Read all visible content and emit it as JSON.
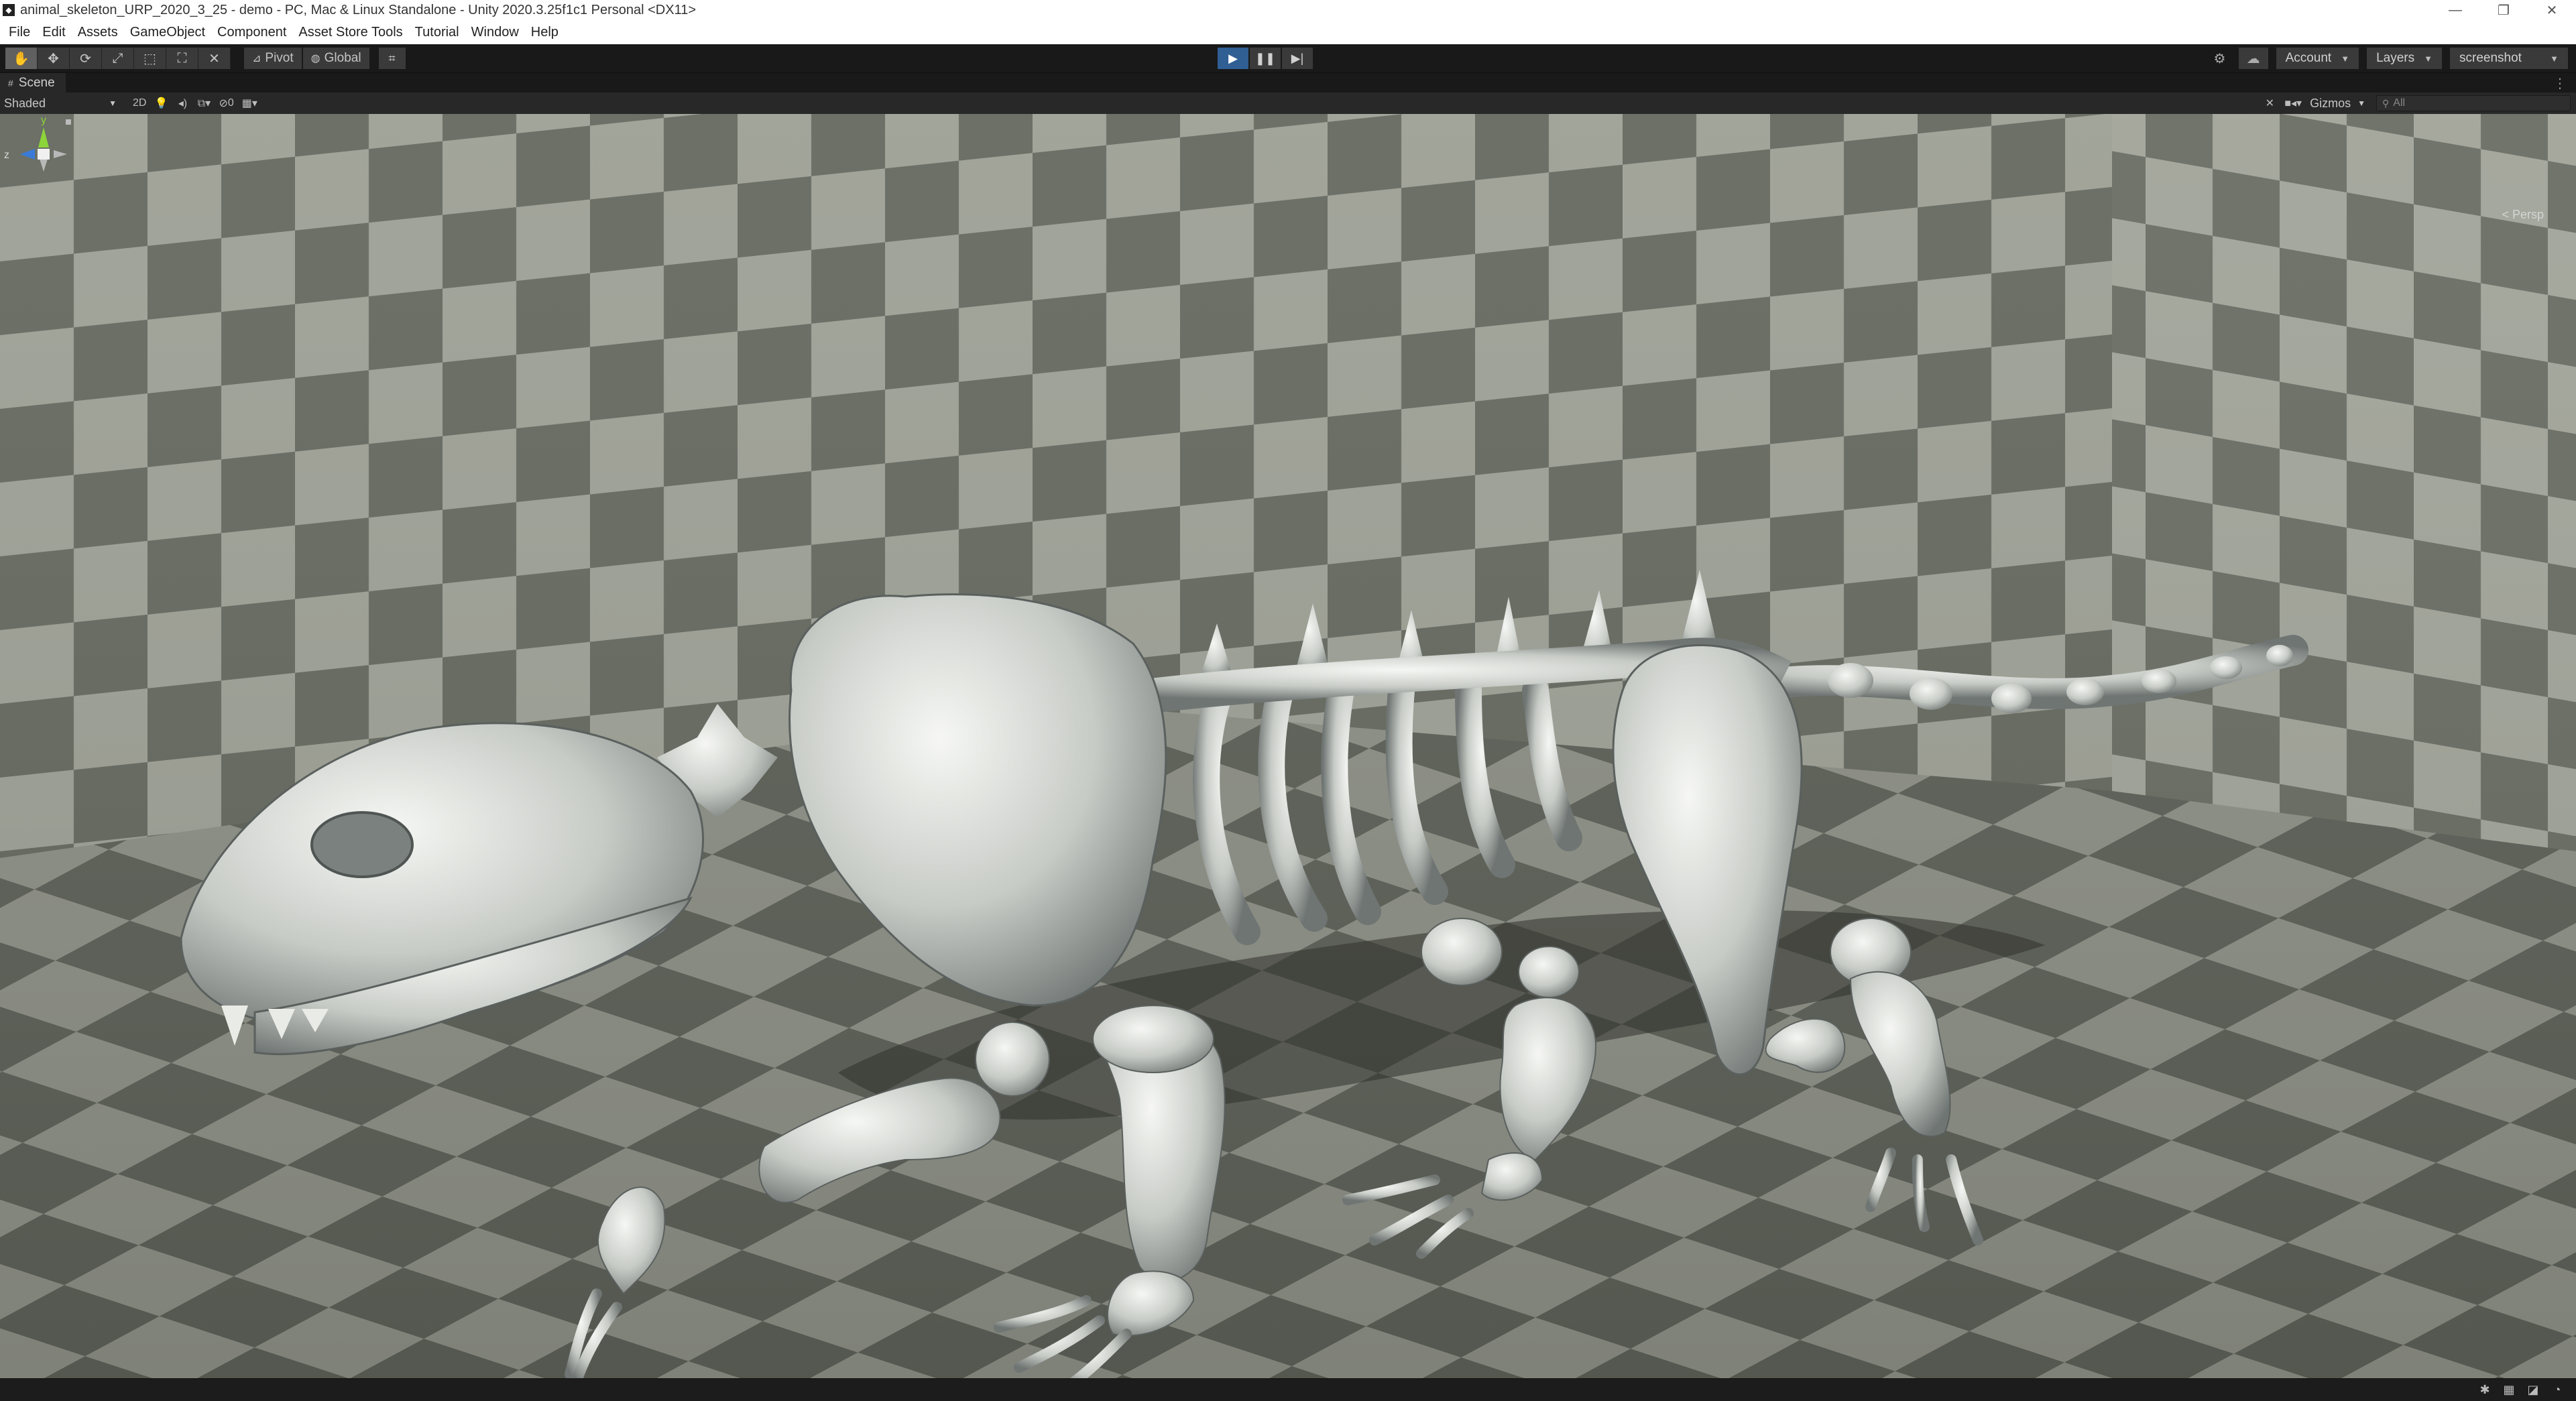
{
  "window": {
    "title": "animal_skeleton_URP_2020_3_25 - demo - PC, Mac & Linux Standalone - Unity 2020.3.25f1c1 Personal <DX11>",
    "icon": "unity-logo-icon",
    "controls": [
      "minimize-icon",
      "restore-icon",
      "close-icon"
    ]
  },
  "menu": [
    "File",
    "Edit",
    "Assets",
    "GameObject",
    "Component",
    "Asset Store Tools",
    "Tutorial",
    "Window",
    "Help"
  ],
  "toolbar": {
    "transform_tools": [
      {
        "name": "hand-tool",
        "icon": "hand-icon",
        "glyph": "✋",
        "active": true
      },
      {
        "name": "move-tool",
        "icon": "move-icon",
        "glyph": "✥",
        "active": false
      },
      {
        "name": "rotate-tool",
        "icon": "rotate-icon",
        "glyph": "⟳",
        "active": false
      },
      {
        "name": "scale-tool",
        "icon": "scale-icon",
        "glyph": "⤢",
        "active": false
      },
      {
        "name": "rect-tool",
        "icon": "rect-icon",
        "glyph": "⬚",
        "active": false
      },
      {
        "name": "transform-tool",
        "icon": "transform-icon",
        "glyph": "⛶",
        "active": false
      },
      {
        "name": "custom-tool",
        "icon": "custom-tool-icon",
        "glyph": "✕",
        "active": false
      }
    ],
    "pivot_label": "Pivot",
    "global_label": "Global",
    "snap_icon": "grid-snap-icon",
    "play_controls": [
      {
        "name": "play-button",
        "icon": "play-icon",
        "glyph": "▶",
        "active": true
      },
      {
        "name": "pause-button",
        "icon": "pause-icon",
        "glyph": "❚❚",
        "active": false
      },
      {
        "name": "step-button",
        "icon": "step-icon",
        "glyph": "▶|",
        "active": false
      }
    ],
    "account_label": "Account",
    "layers_label": "Layers",
    "layout_label": "screenshot"
  },
  "scene_tab": {
    "label": "Scene",
    "icon": "scene-icon"
  },
  "scene_toolbar": {
    "draw_mode": "Shaded",
    "mode_2d": "2D",
    "hidden_count": "0",
    "gizmos_label": "Gizmos",
    "search_placeholder": "All"
  },
  "scene_gizmo": {
    "axis_y": "y",
    "axis_z": "z",
    "projection_label": "< Persp"
  },
  "colors": {
    "play_active": "#2f5f93",
    "toolbar_bg": "#191919",
    "button_bg": "#3a3a3a",
    "checker_light": "#9c9f94",
    "checker_dark": "#5f635a",
    "axis_x": "#d8483a",
    "axis_y": "#8cd43a",
    "axis_z": "#3a7bd8"
  }
}
